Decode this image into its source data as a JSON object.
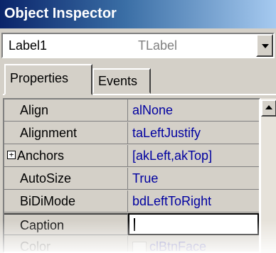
{
  "window": {
    "title": "Object Inspector"
  },
  "component_selector": {
    "name": "Label1",
    "type": "TLabel"
  },
  "tabs": [
    {
      "label": "Properties",
      "active": true
    },
    {
      "label": "Events",
      "active": false
    }
  ],
  "properties": [
    {
      "name": "Align",
      "value": "alNone"
    },
    {
      "name": "Alignment",
      "value": "taLeftJustify"
    },
    {
      "name": "Anchors",
      "value": "[akLeft,akTop]",
      "expandable": true,
      "expander": "+"
    },
    {
      "name": "AutoSize",
      "value": "True"
    },
    {
      "name": "BiDiMode",
      "value": "bdLeftToRight"
    },
    {
      "name": "Caption",
      "value": "",
      "selected": true
    },
    {
      "name": "Color",
      "value": "clBtnFace",
      "faded": true
    }
  ],
  "colors": {
    "title_gradient_start": "#0a246a",
    "title_gradient_end": "#a6caf0",
    "value_text": "#0000a0",
    "panel": "#d4d0c8"
  }
}
